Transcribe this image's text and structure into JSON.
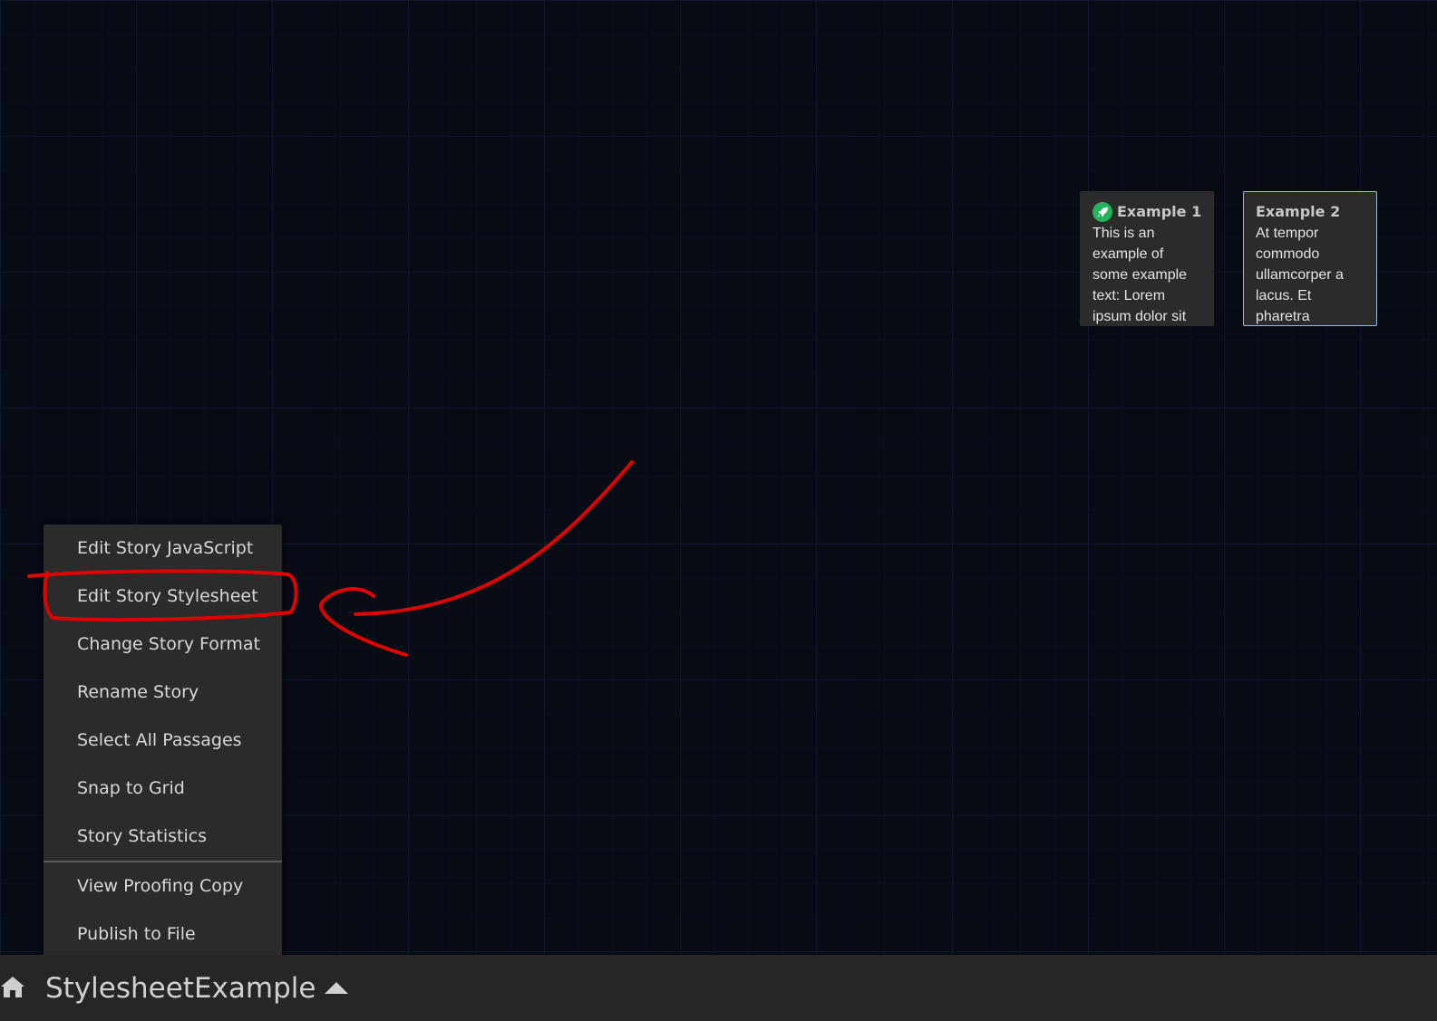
{
  "passages": [
    {
      "title": "Example 1",
      "excerpt": "This is an example of some example text: Lorem ipsum dolor sit",
      "is_start": true,
      "start_icon": "rocket-icon",
      "start_color": "#24b35b"
    },
    {
      "title": "Example 2",
      "excerpt": "At tempor commodo ullamcorper a lacus. Et pharetra",
      "selected": true,
      "highlight_color": "#9bb7e8"
    }
  ],
  "story_menu": {
    "items": [
      {
        "label": "Edit Story JavaScript"
      },
      {
        "label": "Edit Story Stylesheet",
        "annotated": true
      },
      {
        "label": "Change Story Format"
      },
      {
        "label": "Rename Story"
      },
      {
        "label": "Select All Passages"
      },
      {
        "label": "Snap to Grid"
      },
      {
        "label": "Story Statistics"
      },
      {
        "label": "View Proofing Copy"
      },
      {
        "label": "Publish to File"
      }
    ]
  },
  "bottom_bar": {
    "home_icon": "home-icon",
    "story_name": "StylesheetExample",
    "menu_icon": "caret-up-icon"
  },
  "annotation": {
    "color": "#e10000",
    "shapes": [
      "freehand-circle",
      "curved-arrow"
    ]
  },
  "colors": {
    "canvas_bg": "#060b14",
    "panel_bg": "#2b2b2b",
    "bar_bg": "#262626"
  }
}
